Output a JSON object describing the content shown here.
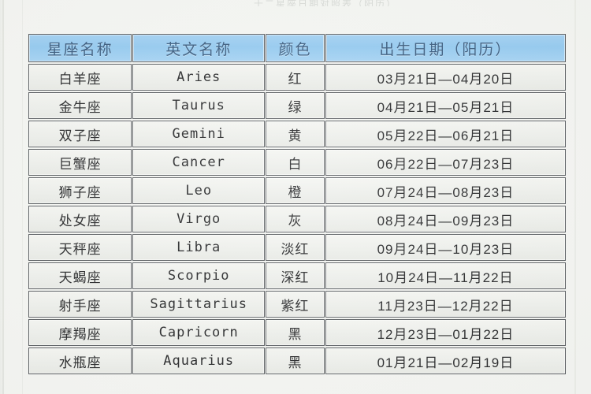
{
  "page": {
    "top_caption": "十二星座日期对照表（阳历）"
  },
  "table": {
    "headers": {
      "cn_name": "星座名称",
      "en_name": "英文名称",
      "color": "颜色",
      "birth_date": "出生日期（阳历）"
    },
    "rows": [
      {
        "cn_name": "白羊座",
        "en_name": "Aries",
        "color": "红",
        "birth_date": "03月21日—04月20日"
      },
      {
        "cn_name": "金牛座",
        "en_name": "Taurus",
        "color": "绿",
        "birth_date": "04月21日—05月21日"
      },
      {
        "cn_name": "双子座",
        "en_name": "Gemini",
        "color": "黄",
        "birth_date": "05月22日—06月21日"
      },
      {
        "cn_name": "巨蟹座",
        "en_name": "Cancer",
        "color": "白",
        "birth_date": "06月22日—07月23日"
      },
      {
        "cn_name": "狮子座",
        "en_name": "Leo",
        "color": "橙",
        "birth_date": "07月24日—08月23日"
      },
      {
        "cn_name": "处女座",
        "en_name": "Virgo",
        "color": "灰",
        "birth_date": "08月24日—09月23日"
      },
      {
        "cn_name": "天秤座",
        "en_name": "Libra",
        "color": "淡红",
        "birth_date": "09月24日—10月23日"
      },
      {
        "cn_name": "天蝎座",
        "en_name": "Scorpio",
        "color": "深红",
        "birth_date": "10月24日—11月22日"
      },
      {
        "cn_name": "射手座",
        "en_name": "Sagittarius",
        "color": "紫红",
        "birth_date": "11月23日—12月22日"
      },
      {
        "cn_name": "摩羯座",
        "en_name": "Capricorn",
        "color": "黑",
        "birth_date": "12月23日—01月22日"
      },
      {
        "cn_name": "水瓶座",
        "en_name": "Aquarius",
        "color": "黑",
        "birth_date": "01月21日—02月19日"
      }
    ]
  },
  "colors": {
    "header_fill": "#8cc6ef",
    "header_text": "#2b4f75",
    "cell_fill": "#eceeea",
    "cell_text": "#17181a",
    "border": "#4d5155",
    "page_background": "#f3f4f1"
  }
}
